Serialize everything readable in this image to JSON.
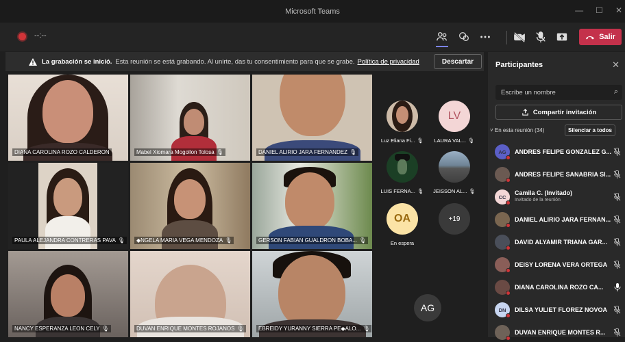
{
  "window": {
    "title": "Microsoft Teams",
    "minimize": "—",
    "maximize": "☐",
    "close": "✕"
  },
  "toolbar": {
    "timer": "--:--",
    "leave_label": "Salir"
  },
  "banner": {
    "title": "La grabación se inició.",
    "message": "Esta reunión se está grabando. Al unirte, das tu consentimiento para que se grabe.",
    "link": "Política de privacidad",
    "dismiss": "Descartar"
  },
  "tiles": [
    {
      "name": "DIANA CAROLINA ROZO CALDERON",
      "muted": false
    },
    {
      "name": "Mabel Xiomara Mogollon Tolosa",
      "muted": true
    },
    {
      "name": "DANIEL ALIRIO JARA FERNANDEZ",
      "muted": true
    },
    {
      "name": "PAULA ALEJANDRA CONTRERAS PAVA",
      "muted": true
    },
    {
      "name": "◆NGELA MARIA VEGA MENDOZA",
      "muted": true
    },
    {
      "name": "GERSON FABIAN GUALDRON BOBA...",
      "muted": true
    },
    {
      "name": "NANCY ESPERANZA LEON CELY",
      "muted": true
    },
    {
      "name": "DUVAN ENRIQUE MONTES ROJANOS",
      "muted": true
    },
    {
      "name": "EBREIDY YURANNY SIERRA PE◆ALO...",
      "muted": true
    }
  ],
  "side": {
    "mini": [
      {
        "name": "Luz Eliana Fi...",
        "initials": ""
      },
      {
        "name": "LAURA VAL...",
        "initials": "LV"
      },
      {
        "name": "LUIS FERNA...",
        "initials": ""
      },
      {
        "name": "JEISSON AL...",
        "initials": ""
      }
    ],
    "waiting_initials": "OA",
    "waiting_label": "En espera",
    "more": "+19",
    "bottom_initials": "AG"
  },
  "panel": {
    "title": "Participantes",
    "search_placeholder": "Escribe un nombre",
    "share": "Compartir invitación",
    "section": "En esta reunión (34)",
    "mute_all": "Silenciar a todos",
    "participants": [
      {
        "name": "ANDRES FELIPE GONZALEZ G...",
        "initials": "AG",
        "color": "#5b5fc7",
        "sub": ""
      },
      {
        "name": "ANDRES FELIPE SANABRIA SI...",
        "initials": "",
        "color": "#6b5a52",
        "sub": ""
      },
      {
        "name": "Camila C. (Invitado)",
        "initials": "CC",
        "color": "#f3d6d6",
        "sub": "Invitado de la reunión"
      },
      {
        "name": "DANIEL ALIRIO JARA FERNAN...",
        "initials": "",
        "color": "#7a6650",
        "sub": ""
      },
      {
        "name": "DAVID ALYAMIR TRIANA GAR...",
        "initials": "",
        "color": "#4a4f5a",
        "sub": ""
      },
      {
        "name": "DEISY LORENA VERA ORTEGA",
        "initials": "",
        "color": "#8a5e58",
        "sub": ""
      },
      {
        "name": "DIANA CAROLINA ROZO CA...",
        "initials": "",
        "color": "#6a4a44",
        "sub": ""
      },
      {
        "name": "DILSA YULIET FLOREZ NOVOA",
        "initials": "DN",
        "color": "#c7d5f0",
        "sub": ""
      },
      {
        "name": "DUVAN ENRIQUE MONTES R...",
        "initials": "",
        "color": "#6e6258",
        "sub": ""
      }
    ]
  }
}
